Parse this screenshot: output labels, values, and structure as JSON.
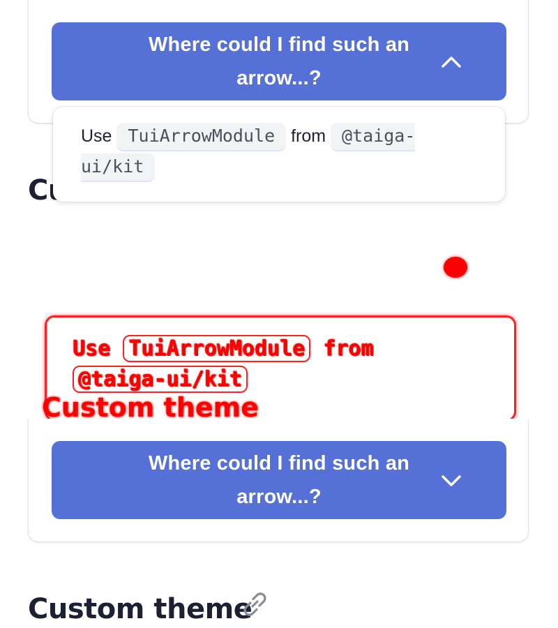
{
  "top_card": {
    "button_label": "Where could I find such an arrow...?",
    "chevron_icon": "chevron-up-icon"
  },
  "dropdown": {
    "text_use": "Use",
    "code_module": "TuiArrowModule",
    "text_from": "from",
    "code_package": "@taiga-ui/kit"
  },
  "section_heading_partial": "Custom theme",
  "diff_overlay": {
    "text_use": "Use",
    "code_module": "TuiArrowModule",
    "text_from": "from",
    "code_package": "@taiga-ui/kit",
    "heading": "Custom theme",
    "color": "#ff0000"
  },
  "bottom_card": {
    "button_label": "Where could I find such an arrow...?",
    "chevron_icon": "chevron-down-icon"
  },
  "section_heading": "Custom theme",
  "link_icon": "link-icon",
  "colors": {
    "accent": "#5570d6",
    "heading": "#1d1f33",
    "code_bg": "#f2f3f5"
  }
}
